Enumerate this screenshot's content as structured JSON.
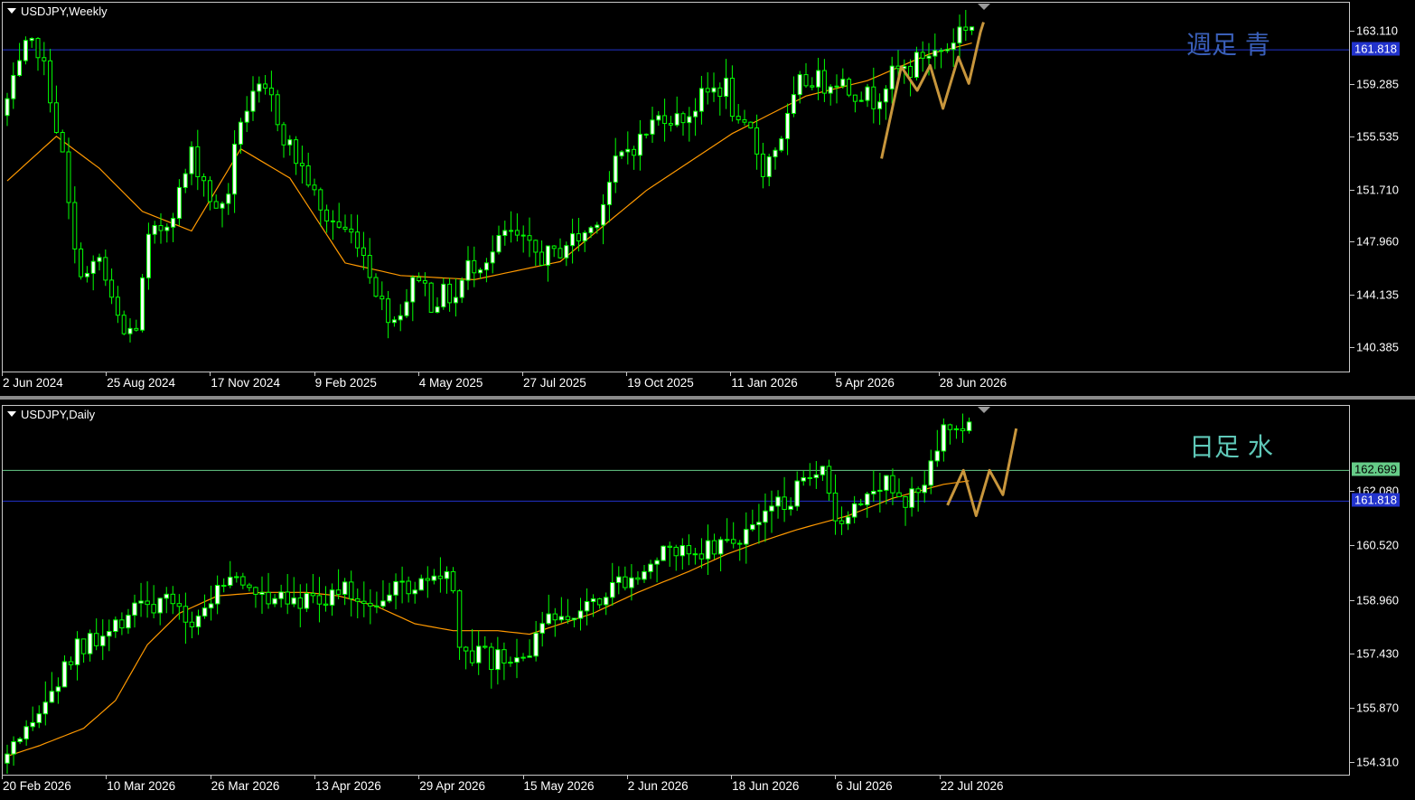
{
  "chart_data": [
    {
      "type": "candlestick",
      "title": "USDJPY,Weekly",
      "annotation": "週足 青",
      "colors": {
        "bull_body": "#ffffff",
        "bear_body": "#000000",
        "wick": "#00ff00",
        "ma": "#ff9900",
        "zigzag": "#c8963c",
        "hline": "#2233cc"
      },
      "ylim": [
        138.7,
        165.2
      ],
      "yticks": [
        "163.110",
        "159.285",
        "155.535",
        "151.710",
        "147.960",
        "144.135",
        "140.385"
      ],
      "xtick_labels": [
        "2 Jun 2024",
        "25 Aug 2024",
        "17 Nov 2024",
        "9 Feb 2025",
        "4 May 2025",
        "27 Jul 2025",
        "19 Oct 2025",
        "11 Jan 2026",
        "5 Apr 2026",
        "28 Jun 2026"
      ],
      "price_lines": [
        {
          "value": 161.818,
          "label": "161.818",
          "color": "#2233cc"
        }
      ],
      "ma_anchors": [
        [
          0,
          152.4
        ],
        [
          8,
          155.6
        ],
        [
          15,
          153.3
        ],
        [
          22,
          150.2
        ],
        [
          30,
          148.8
        ],
        [
          38,
          154.7
        ],
        [
          46,
          152.6
        ],
        [
          55,
          146.5
        ],
        [
          64,
          145.6
        ],
        [
          76,
          145.3
        ],
        [
          90,
          146.6
        ],
        [
          104,
          151.7
        ],
        [
          118,
          155.8
        ],
        [
          130,
          158.5
        ],
        [
          140,
          159.6
        ],
        [
          150,
          161.5
        ],
        [
          157,
          162.3
        ]
      ],
      "candle_count": 158,
      "candle_path": [
        [
          0,
          157.1
        ],
        [
          2,
          159.2
        ],
        [
          4,
          161.7
        ],
        [
          6,
          162.0
        ],
        [
          8,
          158.7
        ],
        [
          10,
          154.0
        ],
        [
          12,
          147.0
        ],
        [
          14,
          145.5
        ],
        [
          16,
          146.8
        ],
        [
          18,
          143.5
        ],
        [
          20,
          141.3
        ],
        [
          22,
          142.0
        ],
        [
          24,
          148.0
        ],
        [
          27,
          149.5
        ],
        [
          29,
          151.5
        ],
        [
          31,
          154.3
        ],
        [
          33,
          152.5
        ],
        [
          35,
          150.0
        ],
        [
          37,
          151.8
        ],
        [
          39,
          157.0
        ],
        [
          42,
          158.7
        ],
        [
          44,
          158.2
        ],
        [
          46,
          155.7
        ],
        [
          48,
          154.0
        ],
        [
          50,
          152.5
        ],
        [
          52,
          150.0
        ],
        [
          54,
          149.5
        ],
        [
          56,
          148.8
        ],
        [
          58,
          148.3
        ],
        [
          60,
          146.0
        ],
        [
          62,
          143.5
        ],
        [
          64,
          142.5
        ],
        [
          66,
          144.0
        ],
        [
          68,
          145.8
        ],
        [
          70,
          143.7
        ],
        [
          72,
          144.2
        ],
        [
          74,
          144.0
        ],
        [
          76,
          146.2
        ],
        [
          78,
          146.7
        ],
        [
          80,
          147.2
        ],
        [
          82,
          148.6
        ],
        [
          84,
          148.2
        ],
        [
          86,
          147.4
        ],
        [
          88,
          147.0
        ],
        [
          90,
          147.0
        ],
        [
          92,
          148.0
        ],
        [
          94,
          148.3
        ],
        [
          96,
          149.0
        ],
        [
          98,
          151.0
        ],
        [
          100,
          153.5
        ],
        [
          102,
          154.7
        ],
        [
          104,
          155.3
        ],
        [
          106,
          156.5
        ],
        [
          108,
          157.3
        ],
        [
          110,
          156.8
        ],
        [
          112,
          157.3
        ],
        [
          114,
          158.3
        ],
        [
          116,
          159.0
        ],
        [
          118,
          159.2
        ],
        [
          120,
          156.0
        ],
        [
          122,
          155.8
        ],
        [
          124,
          153.3
        ],
        [
          126,
          154.8
        ],
        [
          128,
          156.7
        ],
        [
          130,
          159.3
        ],
        [
          132,
          159.8
        ],
        [
          134,
          159.4
        ],
        [
          136,
          159.9
        ],
        [
          138,
          159.0
        ],
        [
          140,
          158.8
        ],
        [
          142,
          158.2
        ],
        [
          144,
          159.5
        ],
        [
          146,
          160.3
        ],
        [
          148,
          160.4
        ],
        [
          150,
          161.5
        ],
        [
          152,
          161.6
        ],
        [
          154,
          162.0
        ],
        [
          156,
          163.3
        ],
        [
          157,
          163.6
        ]
      ],
      "zigzag": [
        [
          142.3,
          154.0
        ],
        [
          145.5,
          160.6
        ],
        [
          148.1,
          158.9
        ],
        [
          150.2,
          160.7
        ],
        [
          152.3,
          157.6
        ],
        [
          154.8,
          161.3
        ],
        [
          156.5,
          159.4
        ],
        [
          158.4,
          163.1
        ],
        [
          158.9,
          163.8
        ]
      ]
    },
    {
      "type": "candlestick",
      "title": "USDJPY,Daily",
      "annotation": "日足 水",
      "colors": {
        "bull_body": "#ffffff",
        "bear_body": "#000000",
        "wick": "#00ff00",
        "ma": "#ff9900",
        "zigzag": "#c8963c",
        "hline": "#2233cc",
        "hline2": "#66cc88"
      },
      "ylim": [
        153.97,
        164.55
      ],
      "yticks": [
        "162.080",
        "160.520",
        "158.960",
        "157.430",
        "155.870",
        "154.310"
      ],
      "xtick_labels": [
        "20 Feb 2026",
        "10 Mar 2026",
        "26 Mar 2026",
        "13 Apr 2026",
        "29 Apr 2026",
        "15 May 2026",
        "2 Jun 2026",
        "18 Jun 2026",
        "6 Jul 2026",
        "22 Jul 2026"
      ],
      "price_lines": [
        {
          "value": 162.699,
          "label": "162.699",
          "color": "#66cc88"
        },
        {
          "value": 161.818,
          "label": "161.818",
          "color": "#2233cc"
        }
      ],
      "ma_anchors": [
        [
          0,
          154.5
        ],
        [
          5,
          154.8
        ],
        [
          12,
          155.3
        ],
        [
          17,
          156.1
        ],
        [
          22,
          157.7
        ],
        [
          27,
          158.6
        ],
        [
          33,
          159.1
        ],
        [
          40,
          159.2
        ],
        [
          47,
          159.2
        ],
        [
          52,
          159.1
        ],
        [
          58,
          158.8
        ],
        [
          64,
          158.3
        ],
        [
          70,
          158.1
        ],
        [
          77,
          158.1
        ],
        [
          82,
          158.0
        ],
        [
          87,
          158.3
        ],
        [
          92,
          158.6
        ],
        [
          99,
          159.2
        ],
        [
          107,
          159.8
        ],
        [
          113,
          160.3
        ],
        [
          119,
          160.7
        ],
        [
          124,
          161.0
        ],
        [
          132,
          161.4
        ],
        [
          139,
          161.9
        ],
        [
          147,
          162.3
        ],
        [
          151,
          162.4
        ]
      ],
      "candle_count": 152,
      "candle_path": [
        [
          0,
          154.3
        ],
        [
          3,
          154.7
        ],
        [
          6,
          155.7
        ],
        [
          9,
          156.6
        ],
        [
          12,
          157.6
        ],
        [
          15,
          157.7
        ],
        [
          18,
          158.1
        ],
        [
          21,
          159.0
        ],
        [
          24,
          158.8
        ],
        [
          27,
          158.8
        ],
        [
          30,
          158.4
        ],
        [
          33,
          159.0
        ],
        [
          36,
          159.7
        ],
        [
          39,
          159.2
        ],
        [
          42,
          159.2
        ],
        [
          45,
          159.2
        ],
        [
          48,
          159.0
        ],
        [
          51,
          159.1
        ],
        [
          54,
          159.2
        ],
        [
          57,
          159.0
        ],
        [
          60,
          159.1
        ],
        [
          63,
          159.3
        ],
        [
          66,
          159.4
        ],
        [
          69,
          159.5
        ],
        [
          71,
          159.4
        ],
        [
          72,
          157.3
        ],
        [
          75,
          157.3
        ],
        [
          78,
          157.2
        ],
        [
          81,
          157.2
        ],
        [
          84,
          157.8
        ],
        [
          87,
          158.5
        ],
        [
          90,
          158.8
        ],
        [
          93,
          159.1
        ],
        [
          96,
          159.4
        ],
        [
          99,
          159.8
        ],
        [
          102,
          160.0
        ],
        [
          105,
          160.3
        ],
        [
          108,
          160.5
        ],
        [
          111,
          160.5
        ],
        [
          114,
          160.6
        ],
        [
          117,
          161.0
        ],
        [
          120,
          161.4
        ],
        [
          123,
          161.8
        ],
        [
          126,
          162.2
        ],
        [
          129,
          162.5
        ],
        [
          131,
          161.0
        ],
        [
          133,
          161.6
        ],
        [
          136,
          162.2
        ],
        [
          139,
          162.5
        ],
        [
          141,
          161.7
        ],
        [
          144,
          162.0
        ],
        [
          146,
          163.2
        ],
        [
          148,
          163.8
        ],
        [
          150,
          163.7
        ],
        [
          151,
          163.8
        ]
      ],
      "zigzag": [
        [
          147.6,
          161.7
        ],
        [
          150.1,
          162.7
        ],
        [
          152.1,
          161.4
        ],
        [
          154.2,
          162.7
        ],
        [
          156.3,
          162.0
        ],
        [
          158.4,
          163.9
        ]
      ]
    }
  ]
}
